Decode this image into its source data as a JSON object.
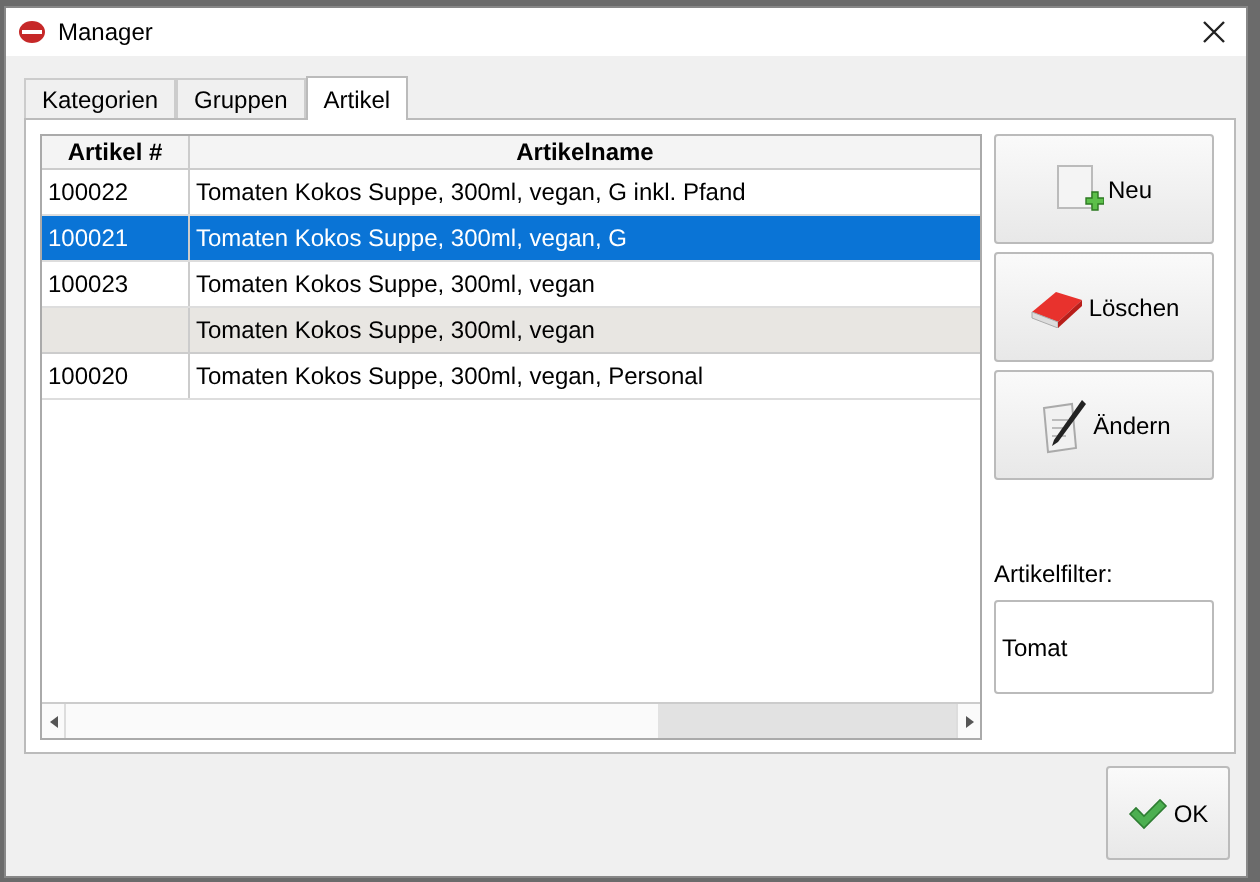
{
  "window": {
    "title": "Manager"
  },
  "tabs": [
    {
      "label": "Kategorien",
      "selected": false
    },
    {
      "label": "Gruppen",
      "selected": false
    },
    {
      "label": "Artikel",
      "selected": true
    }
  ],
  "table": {
    "columns": [
      "Artikel #",
      "Artikelname"
    ],
    "rows": [
      {
        "cells": [
          "100022",
          "Tomaten Kokos Suppe, 300ml, vegan, G inkl. Pfand"
        ],
        "selected": false,
        "shaded": false
      },
      {
        "cells": [
          "100021",
          "Tomaten Kokos Suppe, 300ml, vegan, G"
        ],
        "selected": true,
        "shaded": false
      },
      {
        "cells": [
          "100023",
          "Tomaten Kokos Suppe, 300ml, vegan"
        ],
        "selected": false,
        "shaded": false
      },
      {
        "cells": [
          "",
          "Tomaten Kokos Suppe, 300ml, vegan"
        ],
        "selected": false,
        "shaded": true
      },
      {
        "cells": [
          "100020",
          "Tomaten Kokos Suppe, 300ml, vegan, Personal"
        ],
        "selected": false,
        "shaded": false
      }
    ]
  },
  "actions": [
    {
      "kind": "new",
      "label": "Neu"
    },
    {
      "kind": "delete",
      "label": "Löschen"
    },
    {
      "kind": "edit",
      "label": "Ändern"
    }
  ],
  "filter": {
    "label": "Artikelfilter:",
    "value": "Tomat"
  },
  "ok_button": {
    "label": "OK"
  }
}
